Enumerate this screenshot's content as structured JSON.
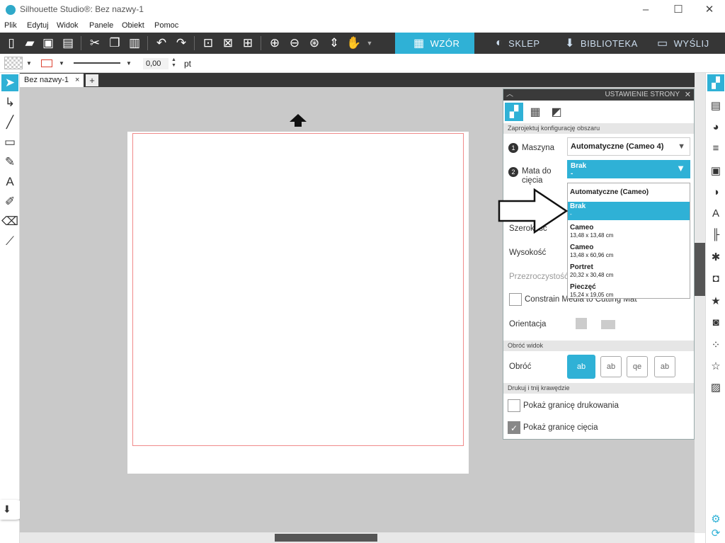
{
  "window": {
    "title": "Silhouette Studio®: Bez nazwy-1",
    "controls": [
      "–",
      "☐",
      "✕"
    ]
  },
  "menu": [
    "Plik",
    "Edytuj",
    "Widok",
    "Panele",
    "Obiekt",
    "Pomoc"
  ],
  "nav_tabs": [
    {
      "label": "WZÓR",
      "icon": "grid-icon",
      "active": true
    },
    {
      "label": "SKLEP",
      "icon": "store-icon",
      "active": false
    },
    {
      "label": "BIBLIOTEKA",
      "icon": "library-icon",
      "active": false
    },
    {
      "label": "WYŚLIJ",
      "icon": "send-icon",
      "active": false
    }
  ],
  "props": {
    "line_width": "0,00",
    "unit": "pt",
    "line_color": "#dd4433"
  },
  "document_tab": {
    "label": "Bez nazwy-1",
    "close": "×",
    "add": "+"
  },
  "panel": {
    "title": "USTAWIENIE STRONY",
    "section_layout": "Zaprojektuj konfigurację obszaru",
    "steps": {
      "one": "1",
      "two": "2"
    },
    "machine_label": "Maszyna",
    "machine_value": "Automatyczne (Cameo 4)",
    "mat_label": "Mata do cięcia",
    "mat_value": "Brak",
    "mat_sub": "-",
    "width_label": "Szerokość",
    "height_label": "Wysokość",
    "transparency_label": "Przezroczystość",
    "constrain_label": "Constrain Media to Cutting Mat",
    "orientation_label": "Orientacja",
    "section_view": "Obróć widok",
    "rotate_label": "Obróć",
    "rotate_options": [
      "ab",
      "ab",
      "qe",
      "ab"
    ],
    "section_print": "Drukuj i tnij krawędzie",
    "show_print_border": "Pokaż granicę drukowania",
    "show_cut_border": "Pokaż granicę cięcia"
  },
  "dropdown": {
    "options": [
      {
        "name": "Automatyczne (Cameo)",
        "size": ""
      },
      {
        "name": "Brak",
        "size": "-"
      },
      {
        "name": "Cameo",
        "size": "13,48 x 13,48 cm"
      },
      {
        "name": "Cameo",
        "size": "13,48 x 60,96 cm"
      },
      {
        "name": "Portret",
        "size": "20,32 x 30,48 cm"
      },
      {
        "name": "Pieczęć",
        "size": "15,24 x 19,05 cm"
      }
    ],
    "selected_index": 1
  },
  "colors": {
    "accent": "#2fb1d6",
    "toolbar": "#363636",
    "canvas": "#c9c9c9",
    "cut_border": "#f08a8a"
  }
}
